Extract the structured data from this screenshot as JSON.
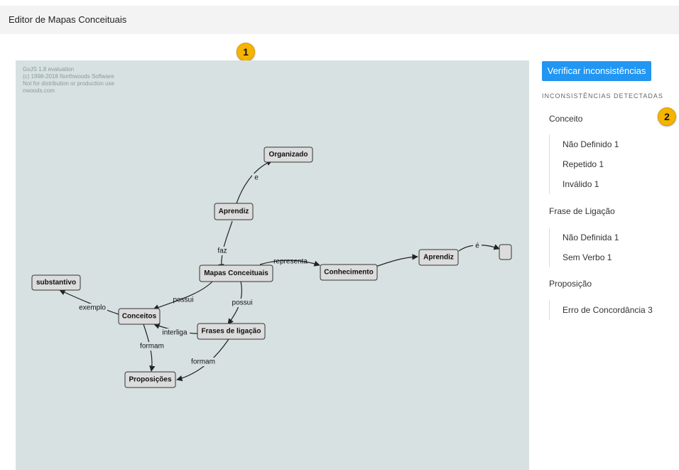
{
  "app": {
    "title": "Editor de Mapas Conceituais"
  },
  "badges": {
    "one": "1",
    "two": "2"
  },
  "colors": {
    "canvas_bg": "#d7e1e1",
    "primary_button": "#2196f3",
    "badge": "#f4b400"
  },
  "canvas": {
    "watermark": [
      "GoJS 1.8 evaluation",
      "(c) 1998-2018 Northwoods Software",
      "Not for distribution or production use",
      "nwoods.com"
    ],
    "nodes": {
      "organizado": "Organizado",
      "aprendiz_top": "Aprendiz",
      "mapas": "Mapas Conceituais",
      "conhecimento": "Conhecimento",
      "aprendiz_right": "Aprendiz",
      "empty": "",
      "substantivo": "substantivo",
      "conceitos": "Conceitos",
      "frases": "Frases de ligação",
      "proposicoes": "Proposições"
    },
    "links": {
      "e": "e",
      "faz": "faz",
      "representa": "representa",
      "e_acento": "é",
      "possui_left": "possui",
      "possui_right": "possui",
      "exemplo": "exemplo",
      "interliga": "interliga",
      "formam_left": "formam",
      "formam_right": "formam"
    }
  },
  "panel": {
    "verify_button": "Verificar inconsistências",
    "heading": "INCONSISTÊNCIAS DETECTADAS",
    "categories": [
      {
        "label": "Conceito",
        "items": [
          "Não Definido 1",
          "Repetido 1",
          "Inválido 1"
        ]
      },
      {
        "label": "Frase de Ligação",
        "items": [
          "Não Definida 1",
          "Sem Verbo 1"
        ]
      },
      {
        "label": "Proposição",
        "items": [
          "Erro de Concordância 3"
        ]
      }
    ]
  }
}
